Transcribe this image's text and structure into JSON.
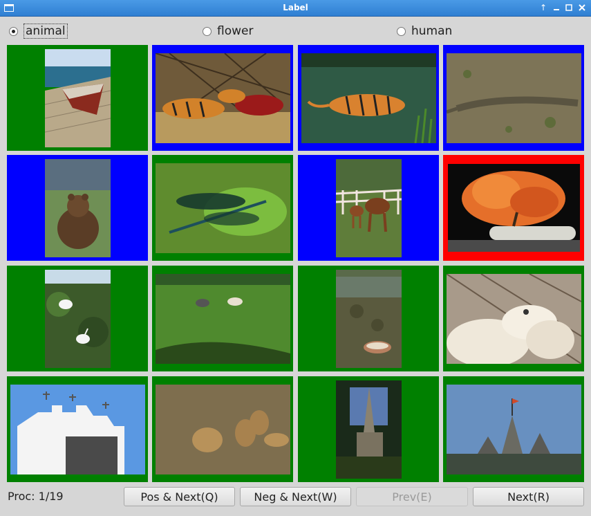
{
  "window": {
    "title": "Label"
  },
  "labels": [
    {
      "text": "animal",
      "selected": true
    },
    {
      "text": "flower",
      "selected": false
    },
    {
      "text": "human",
      "selected": false
    }
  ],
  "colors": {
    "positive": "#008000",
    "negative": "#0000ff",
    "current": "#ff0000"
  },
  "status": {
    "proc": "Proc: 1/19"
  },
  "buttons": {
    "pos_next": "Pos & Next(Q)",
    "neg_next": "Neg & Next(W)",
    "prev": "Prev(E)",
    "next": "Next(R)"
  },
  "cells": [
    {
      "subject": "boat on pier",
      "border": "positive"
    },
    {
      "subject": "tigers with prey",
      "border": "negative"
    },
    {
      "subject": "tiger in water",
      "border": "negative"
    },
    {
      "subject": "crocodile",
      "border": "negative"
    },
    {
      "subject": "bear",
      "border": "negative"
    },
    {
      "subject": "dragonfly",
      "border": "positive"
    },
    {
      "subject": "horses",
      "border": "negative"
    },
    {
      "subject": "bonsai tree",
      "border": "current"
    },
    {
      "subject": "egrets",
      "border": "positive"
    },
    {
      "subject": "horses in field",
      "border": "positive"
    },
    {
      "subject": "boat on shore",
      "border": "positive"
    },
    {
      "subject": "polar bears",
      "border": "positive"
    },
    {
      "subject": "church",
      "border": "positive"
    },
    {
      "subject": "lions",
      "border": "positive"
    },
    {
      "subject": "cathedral",
      "border": "positive"
    },
    {
      "subject": "temple",
      "border": "positive"
    }
  ]
}
